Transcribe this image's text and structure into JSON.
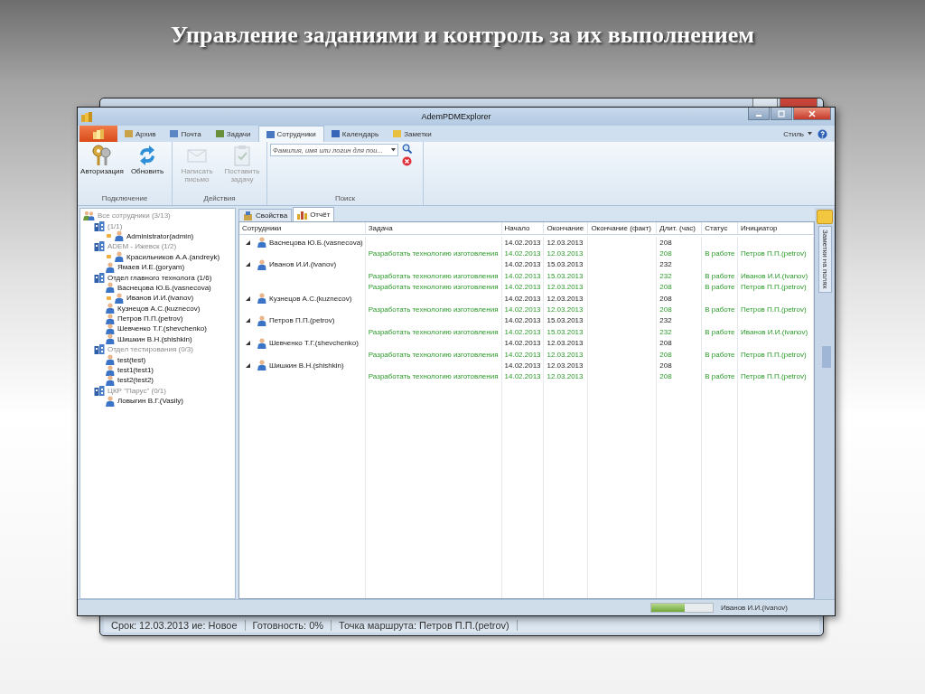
{
  "slide_title": "Управление заданиями и контроль за их выполнением",
  "back_window": {
    "status_items": [
      "Срок: 12.03.2013 ие: Новое",
      "Готовность: 0%",
      "Точка маршрута: Петров П.П.(petrov)"
    ]
  },
  "window": {
    "title": "AdemPDMExplorer"
  },
  "ribbon": {
    "tabs": [
      {
        "label": "Архив",
        "selected": false
      },
      {
        "label": "Почта",
        "selected": false
      },
      {
        "label": "Задачи",
        "selected": false
      },
      {
        "label": "Сотрудники",
        "selected": true
      },
      {
        "label": "Календарь",
        "selected": false
      },
      {
        "label": "Заметки",
        "selected": false
      }
    ],
    "style_menu": "Стиль",
    "groups": [
      {
        "title": "Подключение",
        "kind": "buttons",
        "buttons": [
          {
            "label": "Авторизация",
            "disabled": false
          },
          {
            "label": "Обновить",
            "disabled": false
          }
        ]
      },
      {
        "title": "Действия",
        "kind": "buttons",
        "buttons": [
          {
            "label": "Написать письмо",
            "disabled": true
          },
          {
            "label": "Поставить задачу",
            "disabled": true
          }
        ]
      },
      {
        "title": "Поиск",
        "kind": "search",
        "placeholder": "Фамилия, имя или логин для пои..."
      }
    ]
  },
  "tree": {
    "label": "Все сотрудники (3/13)",
    "kind": "root",
    "dimmed": true,
    "children": [
      {
        "label": "(1/1)",
        "kind": "group",
        "dimmed": true,
        "children": [
          {
            "label": "Administrator(admin)",
            "kind": "person",
            "flagged": true
          }
        ]
      },
      {
        "label": "ADEM - Ижевск (1/2)",
        "kind": "group",
        "dimmed": true,
        "children": [
          {
            "label": "Красильников А.А.(andreyk)",
            "kind": "person",
            "flagged": true
          },
          {
            "label": "Ямаев И.Е.(goryam)",
            "kind": "person",
            "flagged": false
          }
        ]
      },
      {
        "label": "Отдел главного технолога (1/6)",
        "kind": "group",
        "dimmed": false,
        "children": [
          {
            "label": "Васнецова Ю.Б.(vasnecova)",
            "kind": "person",
            "flagged": false
          },
          {
            "label": "Иванов И.И.(ivanov)",
            "kind": "person",
            "flagged": true
          },
          {
            "label": "Кузнецов А.С.(kuznecov)",
            "kind": "person",
            "flagged": false
          },
          {
            "label": "Петров П.П.(petrov)",
            "kind": "person",
            "flagged": false
          },
          {
            "label": "Шевченко Т.Г.(shevchenko)",
            "kind": "person",
            "flagged": false
          },
          {
            "label": "Шишкин В.Н.(shishkin)",
            "kind": "person",
            "flagged": false
          }
        ]
      },
      {
        "label": "Отдел тестирования (0/3)",
        "kind": "group",
        "dimmed": true,
        "children": [
          {
            "label": "test(test)",
            "kind": "person",
            "flagged": false
          },
          {
            "label": "test1(test1)",
            "kind": "person",
            "flagged": false
          },
          {
            "label": "test2(test2)",
            "kind": "person",
            "flagged": false
          }
        ]
      },
      {
        "label": "ЦКР \"Парус\" (0/1)",
        "kind": "group",
        "dimmed": true,
        "children": [
          {
            "label": "Ловыгин В.Г.(Vasily)",
            "kind": "person",
            "flagged": false
          }
        ]
      }
    ]
  },
  "content_tabs": [
    {
      "label": "Свойства",
      "selected": false
    },
    {
      "label": "Отчёт",
      "selected": true
    }
  ],
  "grid": {
    "columns": [
      "Сотрудники",
      "Задача",
      "Начало",
      "Окончание",
      "Окончание (факт)",
      "Длит. (час)",
      "Статус",
      "Инициатор"
    ],
    "rows": [
      {
        "kind": "employee",
        "expanded": true,
        "employee": "Васнецова Ю.Б.(vasnecova)",
        "start": "14.02.2013",
        "end": "12.03.2013",
        "duration": "208"
      },
      {
        "kind": "task",
        "task": "Разработать технологию изготовления",
        "start": "14.02.2013",
        "end": "12.03.2013",
        "duration": "208",
        "status": "В работе",
        "initiator": "Петров П.П.(petrov)"
      },
      {
        "kind": "employee",
        "expanded": true,
        "employee": "Иванов И.И.(ivanov)",
        "start": "14.02.2013",
        "end": "15.03.2013",
        "duration": "232"
      },
      {
        "kind": "task",
        "task": "Разработать технологию изготовления",
        "start": "14.02.2013",
        "end": "15.03.2013",
        "duration": "232",
        "status": "В работе",
        "initiator": "Иванов И.И.(ivanov)"
      },
      {
        "kind": "task",
        "task": "Разработать технологию изготовления",
        "start": "14.02.2013",
        "end": "12.03.2013",
        "duration": "208",
        "status": "В работе",
        "initiator": "Петров П.П.(petrov)"
      },
      {
        "kind": "employee",
        "expanded": true,
        "employee": "Кузнецов А.С.(kuznecov)",
        "start": "14.02.2013",
        "end": "12.03.2013",
        "duration": "208"
      },
      {
        "kind": "task",
        "task": "Разработать технологию изготовления",
        "start": "14.02.2013",
        "end": "12.03.2013",
        "duration": "208",
        "status": "В работе",
        "initiator": "Петров П.П.(petrov)"
      },
      {
        "kind": "employee",
        "expanded": true,
        "employee": "Петров П.П.(petrov)",
        "start": "14.02.2013",
        "end": "15.03.2013",
        "duration": "232"
      },
      {
        "kind": "task",
        "task": "Разработать технологию изготовления",
        "start": "14.02.2013",
        "end": "15.03.2013",
        "duration": "232",
        "status": "В работе",
        "initiator": "Иванов И.И.(ivanov)"
      },
      {
        "kind": "employee",
        "expanded": true,
        "employee": "Шевченко Т.Г.(shevchenko)",
        "start": "14.02.2013",
        "end": "12.03.2013",
        "duration": "208"
      },
      {
        "kind": "task",
        "task": "Разработать технологию изготовления",
        "start": "14.02.2013",
        "end": "12.03.2013",
        "duration": "208",
        "status": "В работе",
        "initiator": "Петров П.П.(petrov)"
      },
      {
        "kind": "employee",
        "expanded": true,
        "employee": "Шишкин В.Н.(shishkin)",
        "start": "14.02.2013",
        "end": "12.03.2013",
        "duration": "208"
      },
      {
        "kind": "task",
        "task": "Разработать технологию изготовления",
        "start": "14.02.2013",
        "end": "12.03.2013",
        "duration": "208",
        "status": "В работе",
        "initiator": "Петров П.П.(petrov)"
      }
    ]
  },
  "notes_panel": {
    "label": "Заметки на полях"
  },
  "status_bar": {
    "progress": {
      "level": 0.55
    },
    "user": "Иванов И.И.(ivanov)"
  }
}
